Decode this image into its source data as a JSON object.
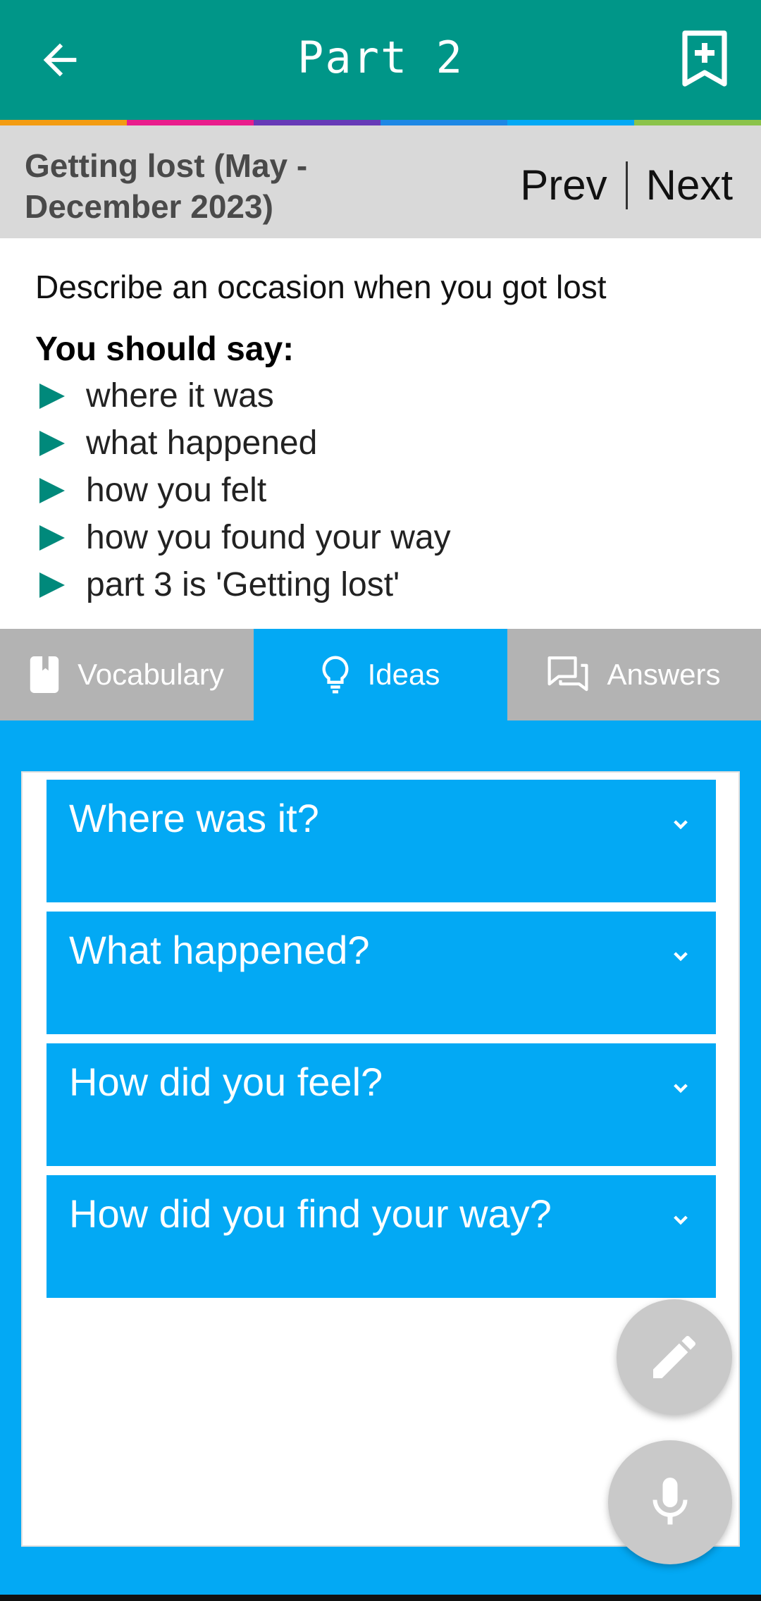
{
  "appbar": {
    "title": "Part 2",
    "back_icon": "arrow-back-icon",
    "bookmark_icon": "bookmark-add-icon",
    "color": "#009688"
  },
  "color_strip": [
    "#f39c12",
    "#e91e8c",
    "#673ab7",
    "#1e88e5",
    "#03a9f4",
    "#8bc34a"
  ],
  "topic": {
    "title": "Getting lost (May - December 2023)",
    "prev_label": "Prev",
    "next_label": "Next"
  },
  "prompt": {
    "description": "Describe an occasion when you got lost",
    "say_label": "You should say:",
    "points": [
      "where it was",
      "what happened",
      "how you felt",
      "how you found your way",
      "part 3 is 'Getting lost'"
    ]
  },
  "tabs": [
    {
      "label": "Vocabulary",
      "icon": "book-icon",
      "active": false
    },
    {
      "label": "Ideas",
      "icon": "lightbulb-icon",
      "active": true
    },
    {
      "label": "Answers",
      "icon": "chat-icon",
      "active": false
    }
  ],
  "accordion": [
    {
      "question": "Where was it?"
    },
    {
      "question": "What happened?"
    },
    {
      "question": "How did you feel?"
    },
    {
      "question": "How did you find your way?"
    }
  ],
  "fabs": {
    "edit_icon": "pencil-icon",
    "mic_icon": "microphone-icon"
  }
}
